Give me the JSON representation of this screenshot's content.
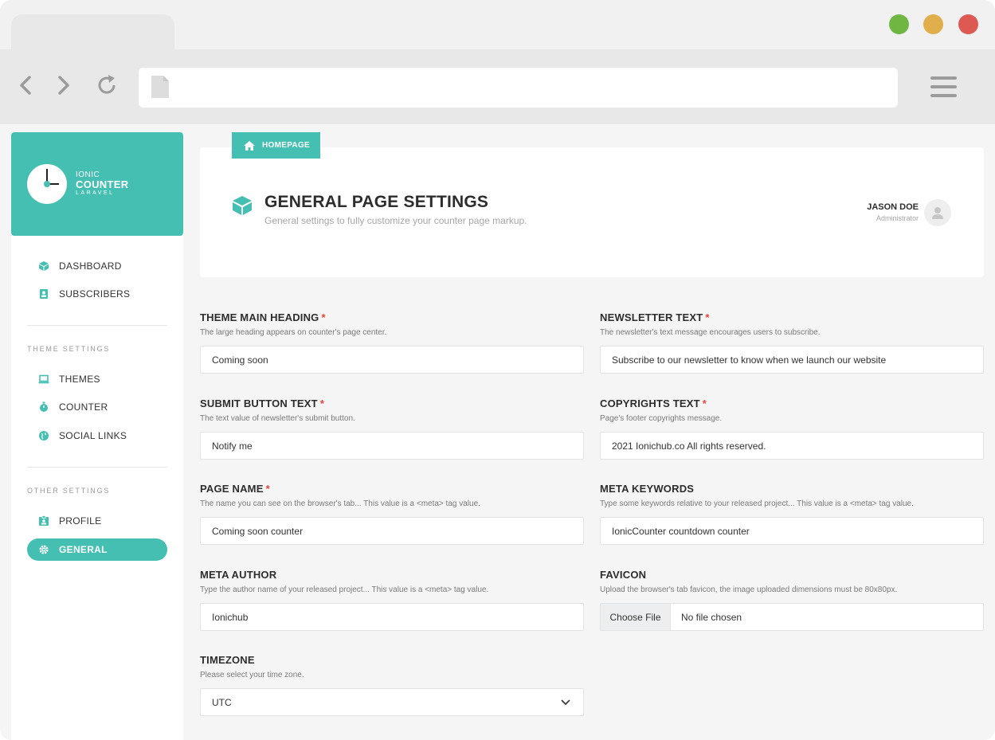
{
  "browser": {
    "window_controls": {
      "green": "#6fb643",
      "yellow": "#e0ae4b",
      "red": "#dd5a52"
    },
    "icons": [
      "back-icon",
      "forward-icon",
      "reload-icon",
      "page-icon",
      "hamburger-menu-icon"
    ]
  },
  "brand": {
    "line1": "IONIC",
    "line2": "COUNTER",
    "line3": "LARAVEL",
    "color": "#45bfb2"
  },
  "sidebar": {
    "main_items": [
      {
        "label": "DASHBOARD",
        "icon": "cube-icon"
      },
      {
        "label": "SUBSCRIBERS",
        "icon": "contact-card-icon"
      }
    ],
    "theme_section": "THEME SETTINGS",
    "theme_items": [
      {
        "label": "THEMES",
        "icon": "laptop-icon"
      },
      {
        "label": "COUNTER",
        "icon": "stopwatch-icon"
      },
      {
        "label": "SOCIAL LINKS",
        "icon": "globe-icon"
      }
    ],
    "other_section": "OTHER SETTINGS",
    "other_items": [
      {
        "label": "PROFILE",
        "icon": "id-badge-icon"
      },
      {
        "label": "GENERAL",
        "icon": "gear-icon",
        "active": true
      }
    ]
  },
  "breadcrumb": {
    "label": "HOMEPAGE",
    "icon": "home-icon"
  },
  "header": {
    "title": "GENERAL PAGE SETTINGS",
    "subtitle": "General settings to fully customize your counter page markup.",
    "user_name": "JASON DOE",
    "user_role": "Administrator"
  },
  "form": {
    "theme_heading": {
      "label": "THEME MAIN HEADING",
      "required": "*",
      "hint": "The large heading appears on counter's page center.",
      "value": "Coming soon"
    },
    "newsletter": {
      "label": "NEWSLETTER TEXT",
      "required": "*",
      "hint": "The newsletter's text message encourages users to subscribe.",
      "value": "Subscribe to our newsletter to know when we launch our website"
    },
    "submit_text": {
      "label": "SUBMIT BUTTON TEXT",
      "required": "*",
      "hint": "The text value of newsletter's submit button.",
      "value": "Notify me"
    },
    "copyrights": {
      "label": "COPYRIGHTS TEXT",
      "required": "*",
      "hint": "Page's footer copyrights message.",
      "value": "2021 Ionichub.co All rights reserved."
    },
    "page_name": {
      "label": "PAGE NAME",
      "required": "*",
      "hint": "The name you can see on the browser's tab... This value is a <meta> tag value.",
      "value": "Coming soon counter"
    },
    "meta_keywords": {
      "label": "META KEYWORDS",
      "hint": "Type some keywords relative to your released project... This value is a <meta> tag value.",
      "value": "IonicCounter countdown counter"
    },
    "meta_author": {
      "label": "META AUTHOR",
      "hint": "Type the author name of your released project... This value is a <meta> tag value.",
      "value": "Ionichub"
    },
    "favicon": {
      "label": "FAVICON",
      "hint": "Upload the browser's tab favicon, the image uploaded dimensions must be 80x80px.",
      "button": "Choose File",
      "status": "No file chosen"
    },
    "timezone": {
      "label": "TIMEZONE",
      "hint": "Please select your time zone.",
      "value": "UTC"
    }
  }
}
